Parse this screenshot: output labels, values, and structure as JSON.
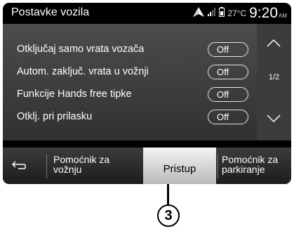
{
  "header": {
    "title": "Postavke vozila",
    "temperature": "27°C",
    "time": "9:20",
    "ampm": "AM",
    "icons": [
      "navigation-arrow-icon",
      "signal-strength-icon",
      "phone-battery-icon"
    ]
  },
  "settings": [
    {
      "label": "Otključaj samo vrata vozača",
      "value": "Off"
    },
    {
      "label": "Autom. zaključ. vrata u vožnji",
      "value": "Off"
    },
    {
      "label": "Funkcije Hands free tipke",
      "value": "Off"
    },
    {
      "label": "Otklj. pri prilasku",
      "value": "Off"
    }
  ],
  "scroll": {
    "page": "1/2",
    "up_icon": "chevron-up-icon",
    "down_icon": "chevron-down-icon"
  },
  "tabs": [
    {
      "label": "Pomoćnik za\nvožnju",
      "active": false
    },
    {
      "label": "Pristup",
      "active": true
    },
    {
      "label": "Pomoćnik za\nparkiranje",
      "active": false
    }
  ],
  "back_icon": "back-arrow-icon",
  "callout": {
    "number": "3"
  },
  "colors": {
    "screen_bg": "#000000",
    "panel": "#3f4143",
    "active_tab": "#e0e0e0"
  }
}
